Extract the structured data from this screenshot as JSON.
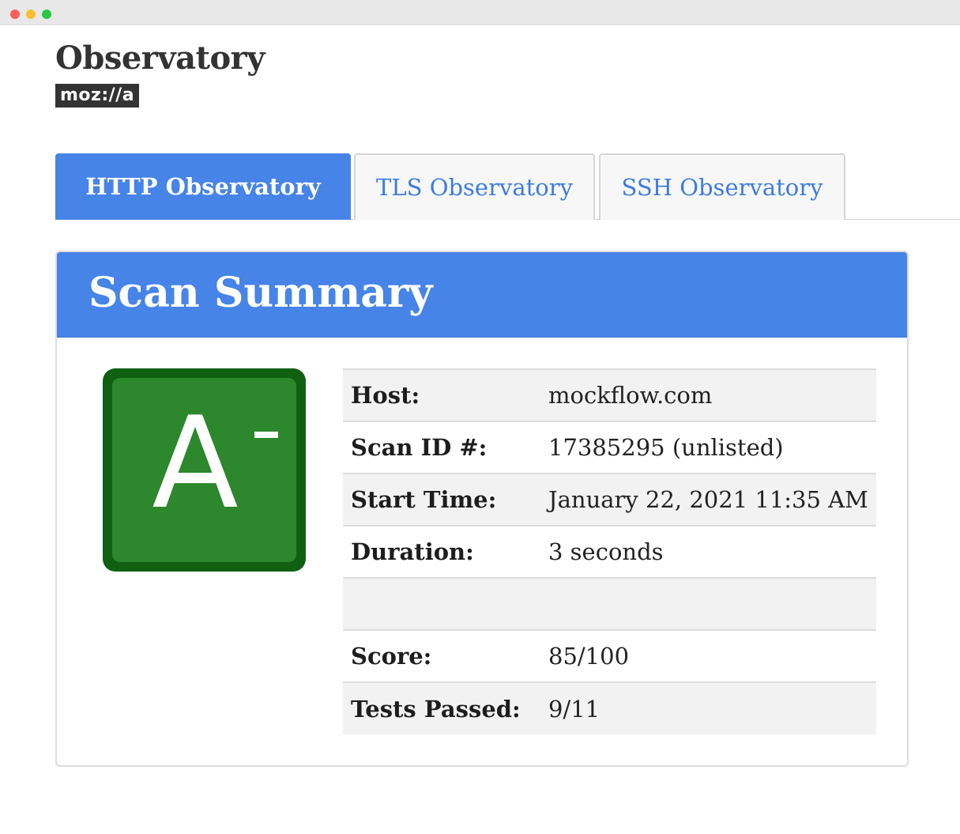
{
  "header": {
    "site_title": "Observatory",
    "brand": "moz://a"
  },
  "tabs": [
    {
      "label": "HTTP Observatory",
      "active": true
    },
    {
      "label": "TLS Observatory",
      "active": false
    },
    {
      "label": "SSH Observatory",
      "active": false
    }
  ],
  "panel": {
    "title": "Scan Summary",
    "grade": {
      "letter": "A",
      "modifier": "-",
      "color": "#2c872d",
      "border_color": "#106012"
    },
    "rows": [
      {
        "key": "Host:",
        "value": "mockflow.com"
      },
      {
        "key": "Scan ID #:",
        "value": "17385295 (unlisted)"
      },
      {
        "key": "Start Time:",
        "value": "January 22, 2021 11:35 AM"
      },
      {
        "key": "Duration:",
        "value": "3 seconds"
      },
      {
        "key": "",
        "value": ""
      },
      {
        "key": "Score:",
        "value": "85/100"
      },
      {
        "key": "Tests Passed:",
        "value": "9/11"
      }
    ]
  },
  "colors": {
    "accent": "#4684e8",
    "tab_link": "#3d7be0"
  }
}
